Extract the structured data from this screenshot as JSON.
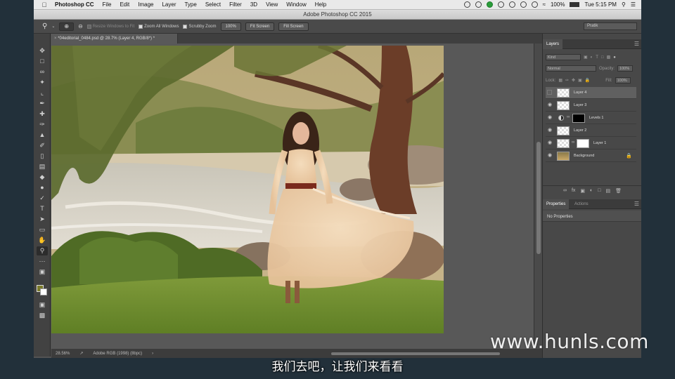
{
  "menubar": {
    "app_name": "Photoshop CC",
    "items": [
      "File",
      "Edit",
      "Image",
      "Layer",
      "Type",
      "Select",
      "Filter",
      "3D",
      "View",
      "Window",
      "Help"
    ],
    "battery": "100%",
    "clock": "Tue 5:15 PM"
  },
  "window": {
    "title": "Adobe Photoshop CC 2015"
  },
  "options": {
    "resize_windows": "Resize Windows to Fit",
    "zoom_all": "Zoom All Windows",
    "scrubby": "Scrubby Zoom",
    "zoom_100": "100%",
    "fit_screen": "Fit Screen",
    "fill_screen": "Fill Screen",
    "workspace": "Pratik"
  },
  "document": {
    "tab_label": "*04editorial_0484.psd @ 28.7% (Layer 4, RGB/8*) *",
    "zoom": "28.56%",
    "profile": "Adobe RGB (1998) (8bpc)"
  },
  "layers_panel": {
    "tab": "Layers",
    "kind": "Kind",
    "blend_mode": "Normal",
    "opacity_label": "Opacity:",
    "opacity": "100%",
    "lock_label": "Lock:",
    "fill_label": "Fill:",
    "fill": "100%",
    "layers": [
      {
        "name": "Layer 4",
        "visible": false,
        "selected": true
      },
      {
        "name": "Layer 3",
        "visible": true
      },
      {
        "name": "Levels 1",
        "visible": true
      },
      {
        "name": "Layer 2",
        "visible": true
      },
      {
        "name": "Layer 1",
        "visible": true
      },
      {
        "name": "Background",
        "visible": true
      }
    ]
  },
  "properties_panel": {
    "tab": "Properties",
    "tab2": "Actions",
    "empty": "No Properties"
  },
  "overlay": {
    "subtitle": "我们去吧，让我们来看看",
    "watermark": "www.hunls.com"
  },
  "colors": {
    "foreground": "#7a7a2a",
    "background": "#ffffff"
  }
}
